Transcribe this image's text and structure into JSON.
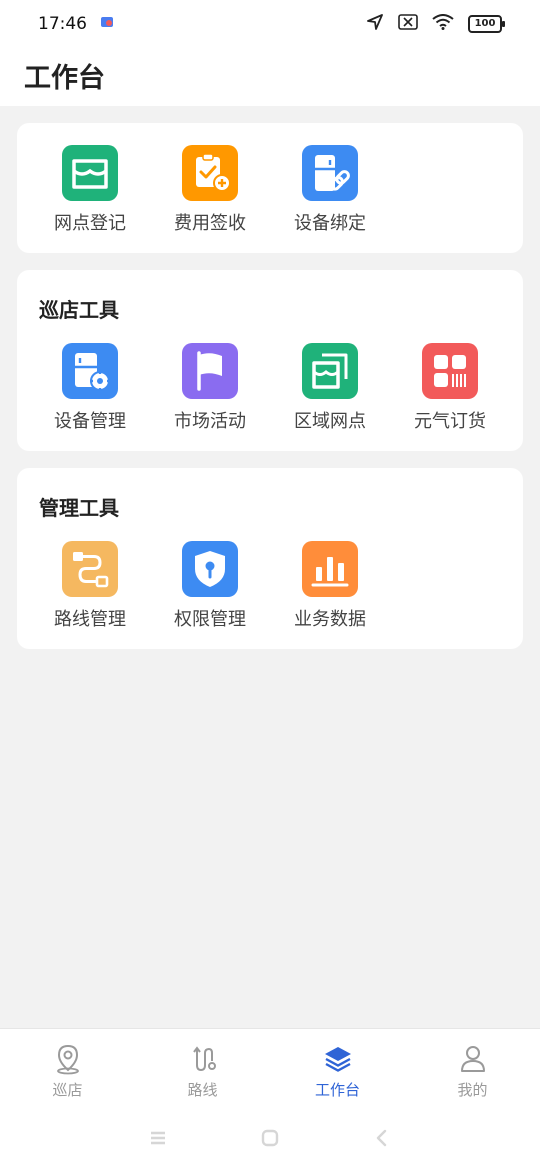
{
  "status": {
    "time": "17:46",
    "battery": "100"
  },
  "header": {
    "title": "工作台"
  },
  "sections": [
    {
      "title": "",
      "items": [
        {
          "label": "网点登记",
          "color": "#1fb27a"
        },
        {
          "label": "费用签收",
          "color": "#ff9800"
        },
        {
          "label": "设备绑定",
          "color": "#3d8bf2"
        }
      ]
    },
    {
      "title": "巡店工具",
      "items": [
        {
          "label": "设备管理",
          "color": "#3d8bf2"
        },
        {
          "label": "市场活动",
          "color": "#8a6cf0"
        },
        {
          "label": "区域网点",
          "color": "#1fb27a"
        },
        {
          "label": "元气订货",
          "color": "#f25a5a"
        }
      ]
    },
    {
      "title": "管理工具",
      "items": [
        {
          "label": "路线管理",
          "color": "#f5b860"
        },
        {
          "label": "权限管理",
          "color": "#3d8bf2"
        },
        {
          "label": "业务数据",
          "color": "#ff8d3a"
        }
      ]
    }
  ],
  "tabs": [
    {
      "label": "巡店",
      "icon": "location-pin-icon",
      "active": false
    },
    {
      "label": "路线",
      "icon": "route-icon",
      "active": false
    },
    {
      "label": "工作台",
      "icon": "layers-icon",
      "active": true
    },
    {
      "label": "我的",
      "icon": "user-icon",
      "active": false
    }
  ],
  "colors": {
    "accent": "#2f64d6",
    "inactive": "#9a9a9a"
  }
}
